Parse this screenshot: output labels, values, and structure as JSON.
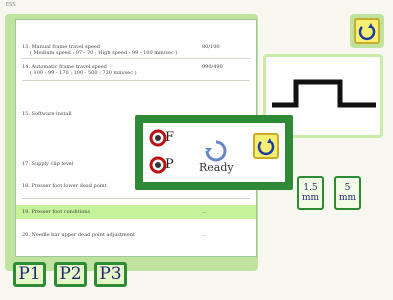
{
  "header": {
    "title": "ESS"
  },
  "rows": [
    {
      "text": "13. Manual frame travel speed",
      "sub": "( Medium speed : 97 - 70 ; High speed : 99 - 100 mm/sec )",
      "value": "80/100"
    },
    {
      "text": "14. Automatic frame travel speed",
      "sub": "( 100 - 99 - 170 ; 100 - 500 ; 720 mm/sec )",
      "value": "990/490"
    },
    {
      "text": "15. Software install",
      "sub": "",
      "value": ""
    },
    {
      "text": "17. Supply clip level",
      "sub": "",
      "value": ""
    },
    {
      "text": "18. Presser foot lower dead point",
      "sub": "",
      "value": ""
    },
    {
      "text": "19. Presser foot conditions",
      "sub": "",
      "value": "..."
    },
    {
      "text": "20. Needle bar upper dead point adjustment",
      "sub": "",
      "value": "..."
    }
  ],
  "pages": [
    "P1",
    "P2",
    "P3"
  ],
  "mm_buttons": [
    {
      "num": "1.5",
      "unit": "mm"
    },
    {
      "num": "5",
      "unit": "mm"
    }
  ],
  "dialog": {
    "off_letter": "F",
    "on_letter": "P",
    "status": "Ready"
  },
  "colors": {
    "accent_green": "#2c8b34",
    "panel": "#bfe39f",
    "highlight": "#c6f29a",
    "yellow": "#f7ee74"
  },
  "icons": {
    "reset": "rotate-icon",
    "spinner": "loading-icon",
    "thread": "spool-icon"
  }
}
